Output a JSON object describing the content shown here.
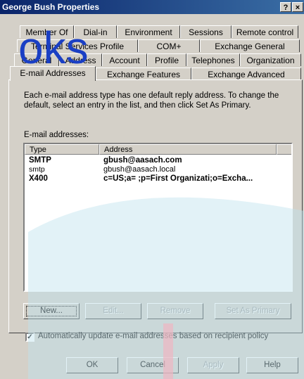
{
  "window": {
    "title": "George Bush Properties",
    "help_glyph": "?",
    "close_glyph": "×"
  },
  "tabs": {
    "row1": [
      "Member Of",
      "Dial-in",
      "Environment",
      "Sessions",
      "Remote control"
    ],
    "row2": [
      "Terminal Services Profile",
      "COM+",
      "Exchange General"
    ],
    "row3": [
      "General",
      "Address",
      "Account",
      "Profile",
      "Telephones",
      "Organization"
    ],
    "row4": [
      "E-mail Addresses",
      "Exchange Features",
      "Exchange Advanced"
    ],
    "active": "E-mail Addresses"
  },
  "watermark": {
    "text": "oks"
  },
  "description": "Each e-mail address type has one default reply address. To change the default, select an entry in the list, and then click Set As Primary.",
  "email_label": "E-mail addresses:",
  "list": {
    "columns": [
      "Type",
      "Address"
    ],
    "rows": [
      {
        "type": "SMTP",
        "address": "gbush@aasach.com",
        "bold": true
      },
      {
        "type": "smtp",
        "address": "gbush@aasach.local",
        "bold": false
      },
      {
        "type": "X400",
        "address": "c=US;a= ;p=First Organizati;o=Excha...",
        "bold": true
      }
    ]
  },
  "buttons": {
    "new": "New...",
    "edit": "Edit...",
    "remove": "Remove",
    "set_primary": "Set As Primary"
  },
  "checkbox": {
    "label": "Automatically update e-mail addresses based on recipient policy",
    "checked": true,
    "mark": "✓"
  },
  "footer": {
    "ok": "OK",
    "cancel": "Cancel",
    "apply": "Apply",
    "help": "Help"
  },
  "colors": {
    "title_bar": "#0a246a",
    "dialog_bg": "#d4d0c8",
    "watermark_cyan": "#bfe3ee",
    "watermark_text": "#1a3fc4"
  }
}
